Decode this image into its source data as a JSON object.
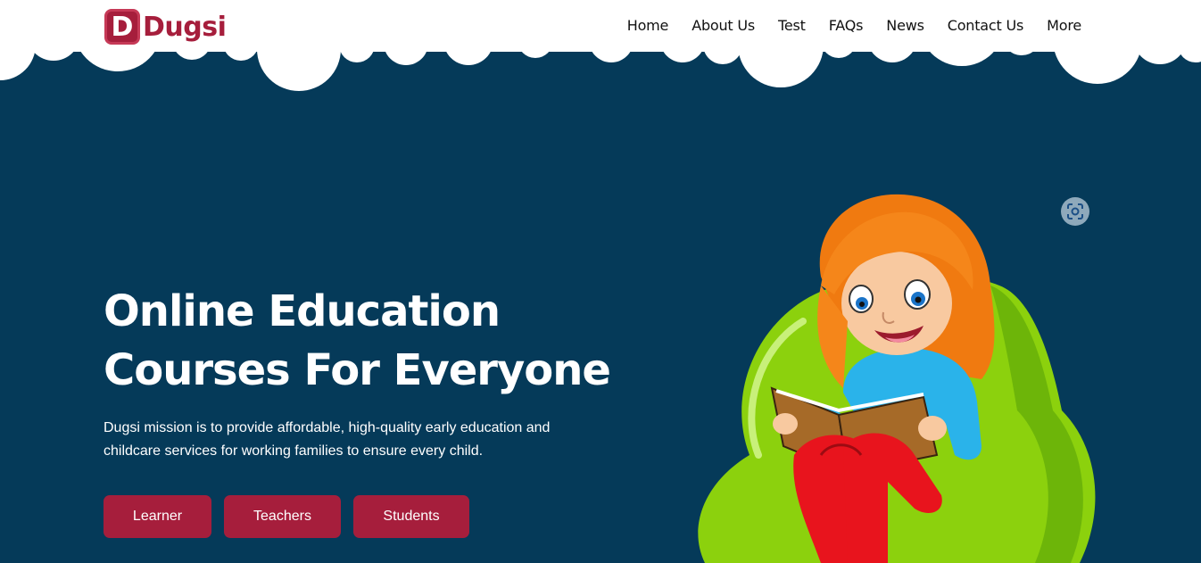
{
  "brand": {
    "logo_letter": "D",
    "name": "Dugsi",
    "color": "#a61e3c"
  },
  "nav": {
    "items": [
      {
        "label": "Home"
      },
      {
        "label": "About Us"
      },
      {
        "label": "Test"
      },
      {
        "label": "FAQs"
      },
      {
        "label": "News"
      },
      {
        "label": "Contact Us"
      },
      {
        "label": "More"
      }
    ]
  },
  "hero": {
    "title_line1": "Online Education",
    "title_line2": "Courses For Everyone",
    "description": "Dugsi mission is to provide affordable, high-quality early education and childcare services for working families to ensure every child.",
    "buttons": [
      {
        "label": "Learner"
      },
      {
        "label": "Teachers"
      },
      {
        "label": "Students"
      }
    ],
    "illustration": "girl-reading-on-beanbag",
    "background_color": "#053a59",
    "button_color": "#a61e3c"
  },
  "lens_icon": "visual-search-icon"
}
